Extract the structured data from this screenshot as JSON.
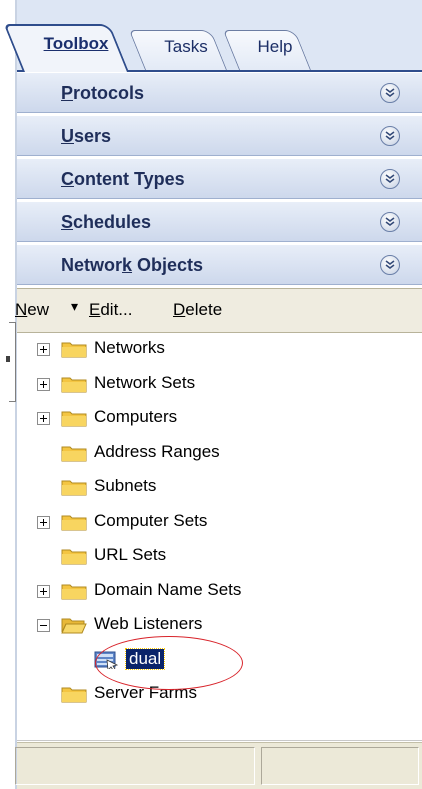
{
  "tabs": [
    {
      "label": "Toolbox",
      "active": true
    },
    {
      "label": "Tasks",
      "active": false
    },
    {
      "label": "Help",
      "active": false
    }
  ],
  "sections": [
    {
      "label": "Protocols",
      "mnemonic": "P",
      "rest": "rotocols"
    },
    {
      "label": "Users",
      "mnemonic": "U",
      "rest": "sers"
    },
    {
      "label": "Content Types",
      "mnemonic": "C",
      "rest": "ontent Types"
    },
    {
      "label": "Schedules",
      "mnemonic": "S",
      "rest": "chedules"
    },
    {
      "label": "Network Objects",
      "pre": "Networ",
      "mnemonic": "k",
      "rest": " Objects"
    }
  ],
  "commands": {
    "new_pre": "",
    "new_mn": "N",
    "new_rest": "ew",
    "edit_pre": "",
    "edit_mn": "E",
    "edit_rest": "dit...",
    "delete_pre": "",
    "delete_mn": "D",
    "delete_rest": "elete"
  },
  "tree": [
    {
      "label": "Networks",
      "expander": "plus"
    },
    {
      "label": "Network Sets",
      "expander": "plus"
    },
    {
      "label": "Computers",
      "expander": "plus"
    },
    {
      "label": "Address Ranges",
      "expander": "none"
    },
    {
      "label": "Subnets",
      "expander": "none"
    },
    {
      "label": "Computer Sets",
      "expander": "plus"
    },
    {
      "label": "URL Sets",
      "expander": "none"
    },
    {
      "label": "Domain Name Sets",
      "expander": "plus"
    },
    {
      "label": "Web Listeners",
      "expander": "minus"
    },
    {
      "label": "dual",
      "expander": "none",
      "child": true,
      "selected": true
    },
    {
      "label": "Server Farms",
      "expander": "none"
    }
  ],
  "colors": {
    "selection": "#0a246a",
    "annotation_circle": "#d8242b",
    "folder": "#f4c542"
  }
}
